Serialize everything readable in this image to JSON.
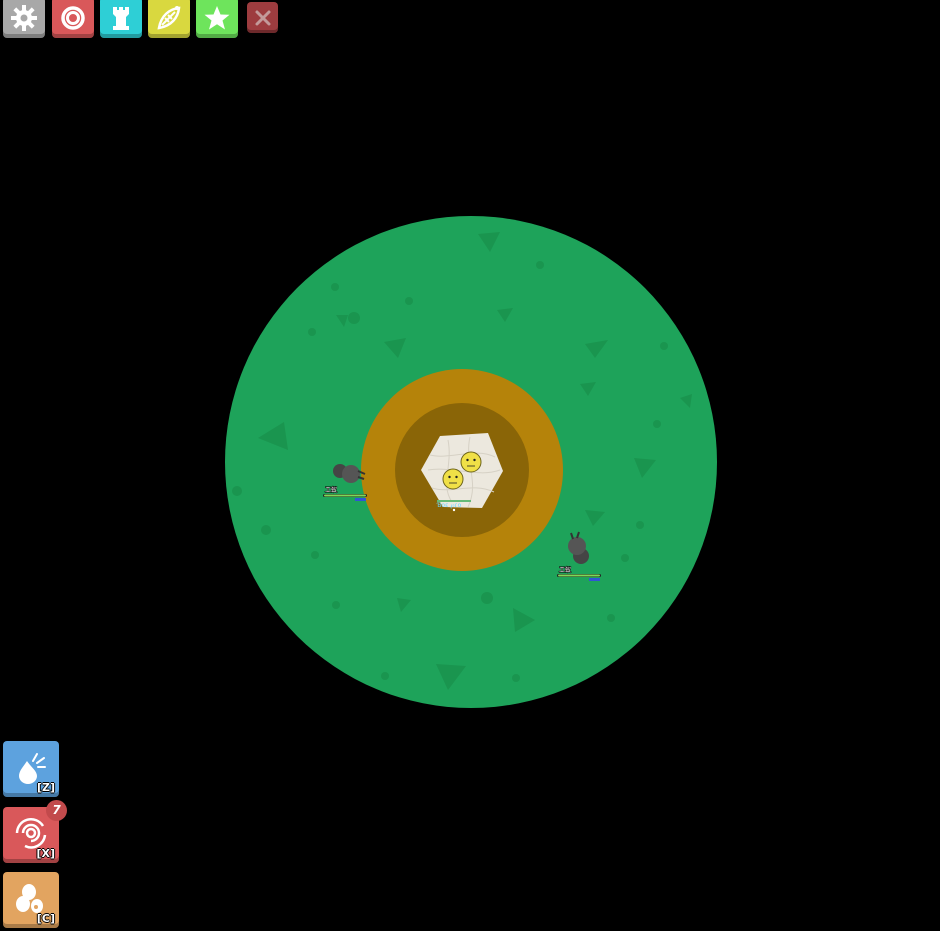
{
  "toolbar": {
    "buttons": [
      {
        "name": "settings-button",
        "icon": "gear-icon",
        "color": "#a8a8a8"
      },
      {
        "name": "inventory-button",
        "icon": "ring-icon",
        "color": "#d9585a"
      },
      {
        "name": "build-button",
        "icon": "castle-icon",
        "color": "#2ecfd6"
      },
      {
        "name": "abilities-button",
        "icon": "leaf-icon",
        "color": "#d9d83f"
      },
      {
        "name": "achievements-button",
        "icon": "star-icon",
        "color": "#6ee45c"
      }
    ],
    "close": {
      "icon": "close-icon",
      "color": "#b9474a"
    }
  },
  "map": {
    "grass_color": "#1ea35a",
    "outer_ring_color": "#b5830a",
    "inner_ring_color": "#8a6507",
    "nest_color": "#ece8de"
  },
  "units": [
    {
      "label": "工蚁",
      "health": 1.0
    },
    {
      "label": "工蚁",
      "health": 1.0
    }
  ],
  "hive": {
    "label": "Ɓoɛ ℘ɾo"
  },
  "actions": [
    {
      "name": "ability-z-button",
      "icon": "drop-icon",
      "key": "[Z]",
      "color": "#5da2de"
    },
    {
      "name": "ability-x-button",
      "icon": "spiral-icon",
      "key": "[X]",
      "color": "#d9585a",
      "count": "7"
    },
    {
      "name": "ability-c-button",
      "icon": "eggs-icon",
      "key": "[C]",
      "color": "#e2a460"
    }
  ]
}
